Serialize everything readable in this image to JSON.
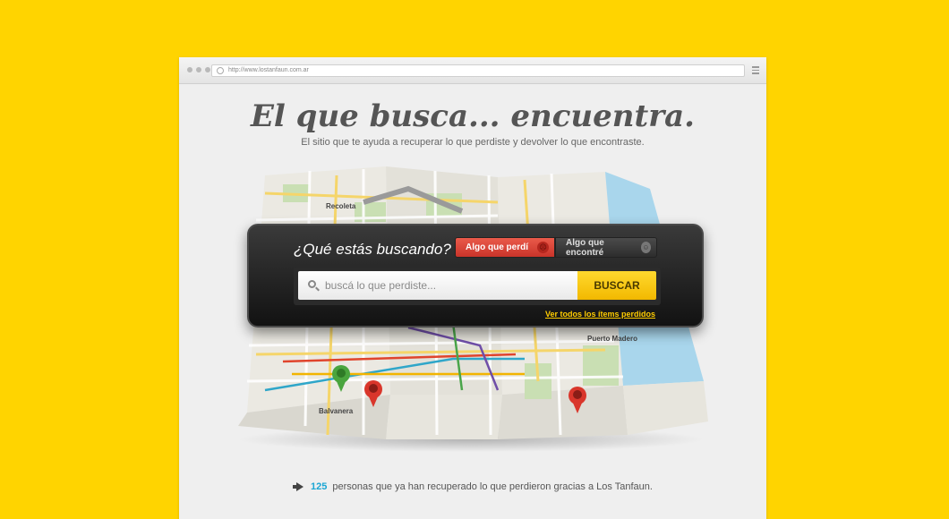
{
  "browser": {
    "url": "http://www.lostanfaun.com.ar"
  },
  "hero": {
    "headline": "El que busca... encuentra.",
    "subtitle": "El sitio que te ayuda a recuperar lo que perdiste y devolver lo que encontraste."
  },
  "map": {
    "labels": [
      "Recoleta",
      "Puerto Madero",
      "Balvanera"
    ]
  },
  "search": {
    "question": "¿Qué estás buscando?",
    "toggle": [
      {
        "label": "Algo que perdí",
        "icon": "sad-face-icon",
        "active": true
      },
      {
        "label": "Algo que encontré",
        "icon": "happy-face-icon",
        "active": false
      }
    ],
    "placeholder": "buscá lo que perdiste...",
    "button_label": "BUSCAR",
    "link": "Ver todos los ítems perdidos"
  },
  "footer": {
    "count": "125",
    "text": "personas que ya han recuperado lo que perdieron gracias a Los Tanfaun."
  },
  "colors": {
    "background": "#FFD400",
    "lost": "#E04A3C",
    "button": "#F7C800",
    "count": "#1AA6D4"
  }
}
